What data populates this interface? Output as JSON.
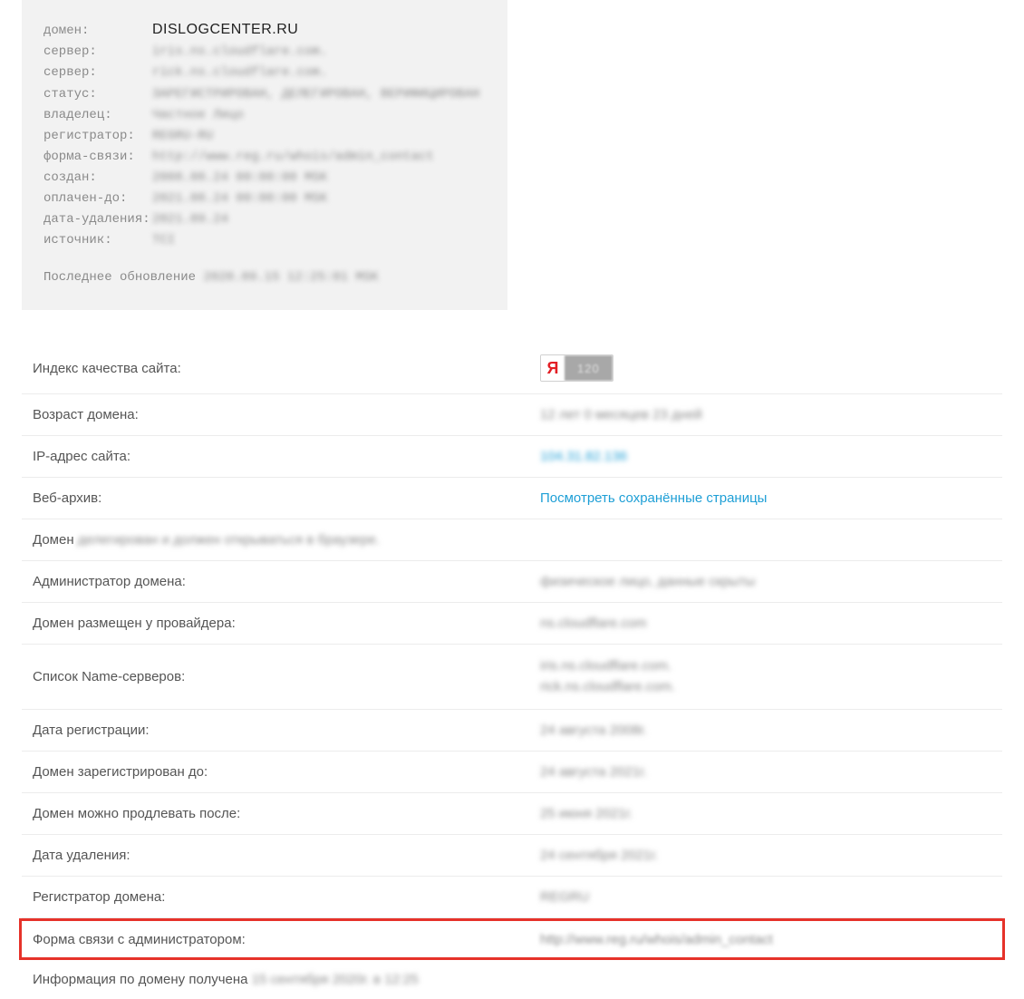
{
  "whois": {
    "rows": [
      {
        "key": "домен:",
        "value": "DISLOGCENTER.RU",
        "cls": "domain"
      },
      {
        "key": "сервер:",
        "value": "iris.ns.cloudflare.com.",
        "cls": "blur"
      },
      {
        "key": "сервер:",
        "value": "rick.ns.cloudflare.com.",
        "cls": "blur"
      },
      {
        "key": "статус:",
        "value": "ЗАРЕГИСТРИРОВАН, ДЕЛЕГИРОВАН, ВЕРИФИЦИРОВАН",
        "cls": "blur"
      },
      {
        "key": "владелец:",
        "value": "Частное Лицо",
        "cls": "blur"
      },
      {
        "key": "регистратор:",
        "value": "REGRU-RU",
        "cls": "blur"
      },
      {
        "key": "форма-связи:",
        "value": "http://www.reg.ru/whois/admin_contact",
        "cls": "blur"
      },
      {
        "key": "создан:",
        "value": "2008.08.24 00:00:00 MSK",
        "cls": "blur"
      },
      {
        "key": "оплачен-до:",
        "value": "2021.08.24 00:00:00 MSK",
        "cls": "blur"
      },
      {
        "key": "дата-удаления:",
        "value": "2021.09.24",
        "cls": "blur"
      },
      {
        "key": "источник:",
        "value": "TCI",
        "cls": "blur"
      }
    ],
    "footer_label": "Последнее обновление ",
    "footer_value": "2020.09.15 12:25:01 MSK"
  },
  "details": {
    "quality_label": "Индекс качества сайта:",
    "yandex_letter": "Я",
    "yandex_score": "120",
    "age_label": "Возраст домена:",
    "age_value": "12 лет 0 месяцев 23 дней",
    "ip_label": "IP-адрес сайта:",
    "ip_value": "104.31.82.136",
    "webarchive_label": "Веб-архив:",
    "webarchive_value": "Посмотреть сохранённые страницы",
    "domain_prefix": "Домен ",
    "domain_status_blur": "делегирован и должен открываться в браузере.",
    "admin_label": "Администратор домена:",
    "admin_value": "физическое лицо, данные скрыты",
    "provider_label": "Домен размещен у провайдера:",
    "provider_value": "ns.cloudflare.com",
    "ns_label": "Список Name-серверов:",
    "ns_value_1": "iris.ns.cloudflare.com.",
    "ns_value_2": "rick.ns.cloudflare.com.",
    "regdate_label": "Дата регистрации:",
    "regdate_value": "24 августа 2008г.",
    "reguntil_label": "Домен зарегистрирован до:",
    "reguntil_value": "24 августа 2021г.",
    "renew_label": "Домен можно продлевать после:",
    "renew_value": "25 июня 2021г.",
    "deldate_label": "Дата удаления:",
    "deldate_value": "24 сентября 2021г.",
    "registrar_label": "Регистратор домена:",
    "registrar_value": "REGRU",
    "contact_label": "Форма связи с администратором:",
    "contact_value": "http://www.reg.ru/whois/admin_contact",
    "footer_prefix": "Информация по домену получена ",
    "footer_value": "15 сентября 2020г. в 12:25"
  }
}
